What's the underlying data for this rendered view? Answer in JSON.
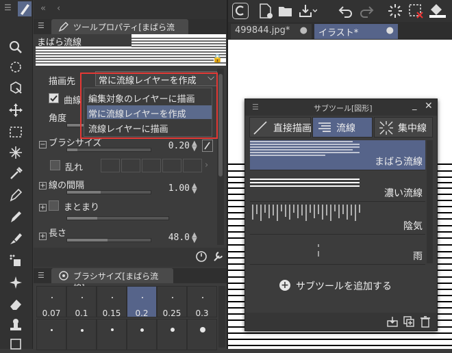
{
  "tool_panel": {
    "tab_label": "ツールプロパティ[まばら流線]",
    "preview_label": "まばら流線",
    "draw_target": {
      "label": "描画先",
      "value": "常に流線レイヤーを作成"
    },
    "curve_label": "曲線",
    "angle_label": "角度",
    "brush_size": {
      "label": "ブラシサイズ",
      "value": "0.20"
    },
    "disorder_label": "乱れ",
    "line_interval": {
      "label": "線の間隔",
      "value": "1.00"
    },
    "grouping_label": "まとまり",
    "length": {
      "label": "長さ",
      "value": "48.0"
    }
  },
  "dropdown": {
    "items": [
      "編集対象のレイヤーに描画",
      "常に流線レイヤーを作成",
      "流線レイヤーに描画"
    ],
    "selected_index": 1
  },
  "brush_size_panel": {
    "tab_label": "ブラシサイズ[まばら流線]",
    "sizes": [
      "0.07",
      "0.1",
      "0.15",
      "0.2",
      "0.25",
      "0.3"
    ],
    "selected": "0.2"
  },
  "doc_tabs": [
    {
      "label": "499844.jpg*"
    },
    {
      "label": "イラスト*"
    }
  ],
  "subtool": {
    "title": "サブツール[図形]",
    "tabs": [
      "直接描画",
      "流線",
      "集中線"
    ],
    "selected_tab": "流線",
    "items": [
      {
        "name": "まばら流線"
      },
      {
        "name": "濃い流線"
      },
      {
        "name": "陰気"
      },
      {
        "name": "雨"
      }
    ],
    "add_label": "サブツールを追加する"
  },
  "colors": {
    "accent": "#56648a",
    "highlight_border": "#e53935"
  }
}
